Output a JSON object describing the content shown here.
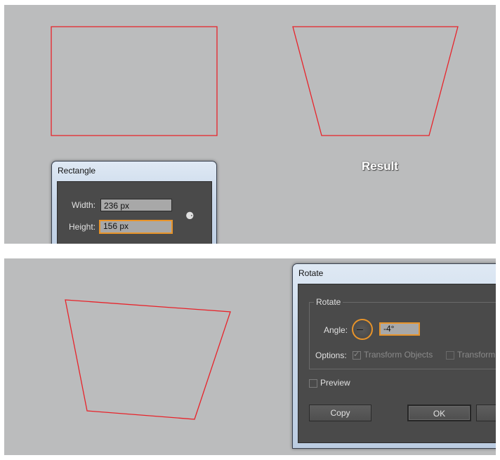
{
  "top_panel": {
    "result_label": "Result"
  },
  "rectangle_dialog": {
    "title": "Rectangle",
    "width_label": "Width:",
    "width_value": "236 px",
    "height_label": "Height:",
    "height_value": "156 px",
    "link_icon": "constrain-proportions-icon"
  },
  "rotate_dialog": {
    "title": "Rotate",
    "group_title": "Rotate",
    "angle_label": "Angle:",
    "angle_value": "-4°",
    "options_label": "Options:",
    "transform_objects_label": "Transform Objects",
    "transform_objects_checked": true,
    "transform_patterns_label": "Transform",
    "preview_label": "Preview",
    "preview_checked": false,
    "copy_label": "Copy",
    "ok_label": "OK"
  },
  "colors": {
    "canvas": "#bbbcbd",
    "shape_stroke": "#e8232a",
    "dialog_body": "#4a4a4a",
    "focus_accent": "#e8942a"
  }
}
